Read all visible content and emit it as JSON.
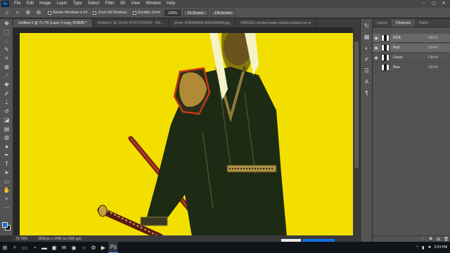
{
  "menubar": {
    "logo_text": "Ps",
    "items": [
      "File",
      "Edit",
      "Image",
      "Layer",
      "Type",
      "Select",
      "Filter",
      "3D",
      "View",
      "Window",
      "Help"
    ],
    "window_controls": [
      "–",
      "▢",
      "✕"
    ]
  },
  "options": {
    "resize_windows": "Resize Windows to Fit",
    "zoom_all": "Zoom All Windows",
    "scrubby_zoom": "Scrubby Zoom",
    "zoom_value": "100%",
    "fit_screen": "Fit Screen",
    "fill_screen": "Fill Screen"
  },
  "tabs": [
    {
      "label": "Untitled-1 @ 71.7% (Layer 3 copy, RGB/8) *",
      "active": true
    },
    {
      "label": "Untitled-2 @ 24.4% (PHOTOSHOP , RG...",
      "active": false
    },
    {
      "label": "photo-1546484396-fb3fc6f95f98.jpg",
      "active": false
    },
    {
      "label": "29652811-twisted-water-splash-isolated-on-w",
      "active": false
    }
  ],
  "status": {
    "zoom": "70.79%",
    "doc_info": "3508 px x 2480 px (300 ppi)"
  },
  "channels_panel": {
    "tabs": [
      {
        "label": "Layers",
        "active": false
      },
      {
        "label": "Channels",
        "active": true
      },
      {
        "label": "Paths",
        "active": false
      }
    ],
    "channels": [
      {
        "name": "RGB",
        "shortcut": "Ctrl+2",
        "visible": true,
        "selected": true
      },
      {
        "name": "Red",
        "shortcut": "Ctrl+3",
        "visible": true,
        "selected": true
      },
      {
        "name": "Green",
        "shortcut": "Ctrl+4",
        "visible": true,
        "selected": false
      },
      {
        "name": "Blue",
        "shortcut": "Ctrl+5",
        "visible": false,
        "selected": false
      }
    ]
  },
  "taskbar": {
    "time": "3:54 PM",
    "date": "",
    "tray_icons": [
      "chevron-up-icon",
      "network-icon",
      "volume-icon"
    ]
  },
  "colors": {
    "canvas_yellow": "#f2df00",
    "accent_blue": "#1473e6",
    "foreground_swatch": "#1f6fd6"
  }
}
